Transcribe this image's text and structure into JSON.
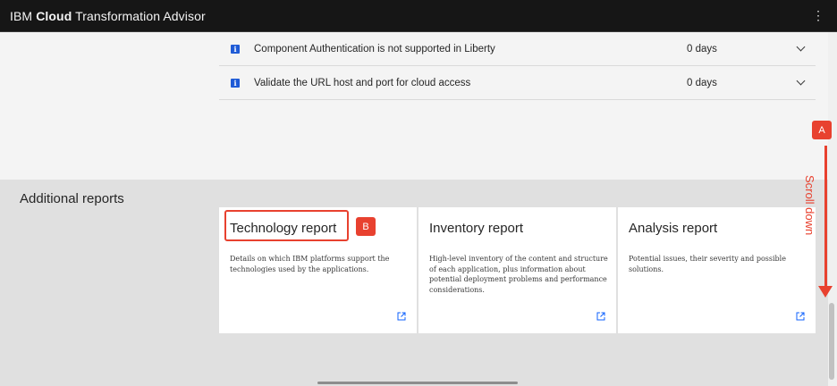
{
  "header": {
    "brand_prefix": "IBM",
    "brand_bold": "Cloud",
    "brand_suffix": "Transformation Advisor",
    "menu_glyph": "⋮"
  },
  "issues": [
    {
      "icon": "info-icon",
      "text": "Component Authentication is not supported in Liberty",
      "days": "0 days"
    },
    {
      "icon": "info-icon",
      "text": "Validate the URL host and port for cloud access",
      "days": "0 days"
    }
  ],
  "additional_reports": {
    "title": "Additional reports",
    "cards": [
      {
        "title": "Technology report",
        "description": "Details on which IBM platforms support the technologies used by the applications."
      },
      {
        "title": "Inventory report",
        "description": "High-level inventory of the content and structure of each application, plus information about potential deployment problems and performance considerations."
      },
      {
        "title": "Analysis report",
        "description": "Potential issues, their severity and possible solutions."
      }
    ]
  },
  "annotations": {
    "badge_a": "A",
    "badge_b": "B",
    "scroll_label": "Scroll down",
    "color": "#e8412f"
  },
  "colors": {
    "header_bg": "#161616",
    "info_icon": "#1f5bd6",
    "top_bg": "#f4f4f4",
    "bottom_bg": "#e0e0e0"
  }
}
